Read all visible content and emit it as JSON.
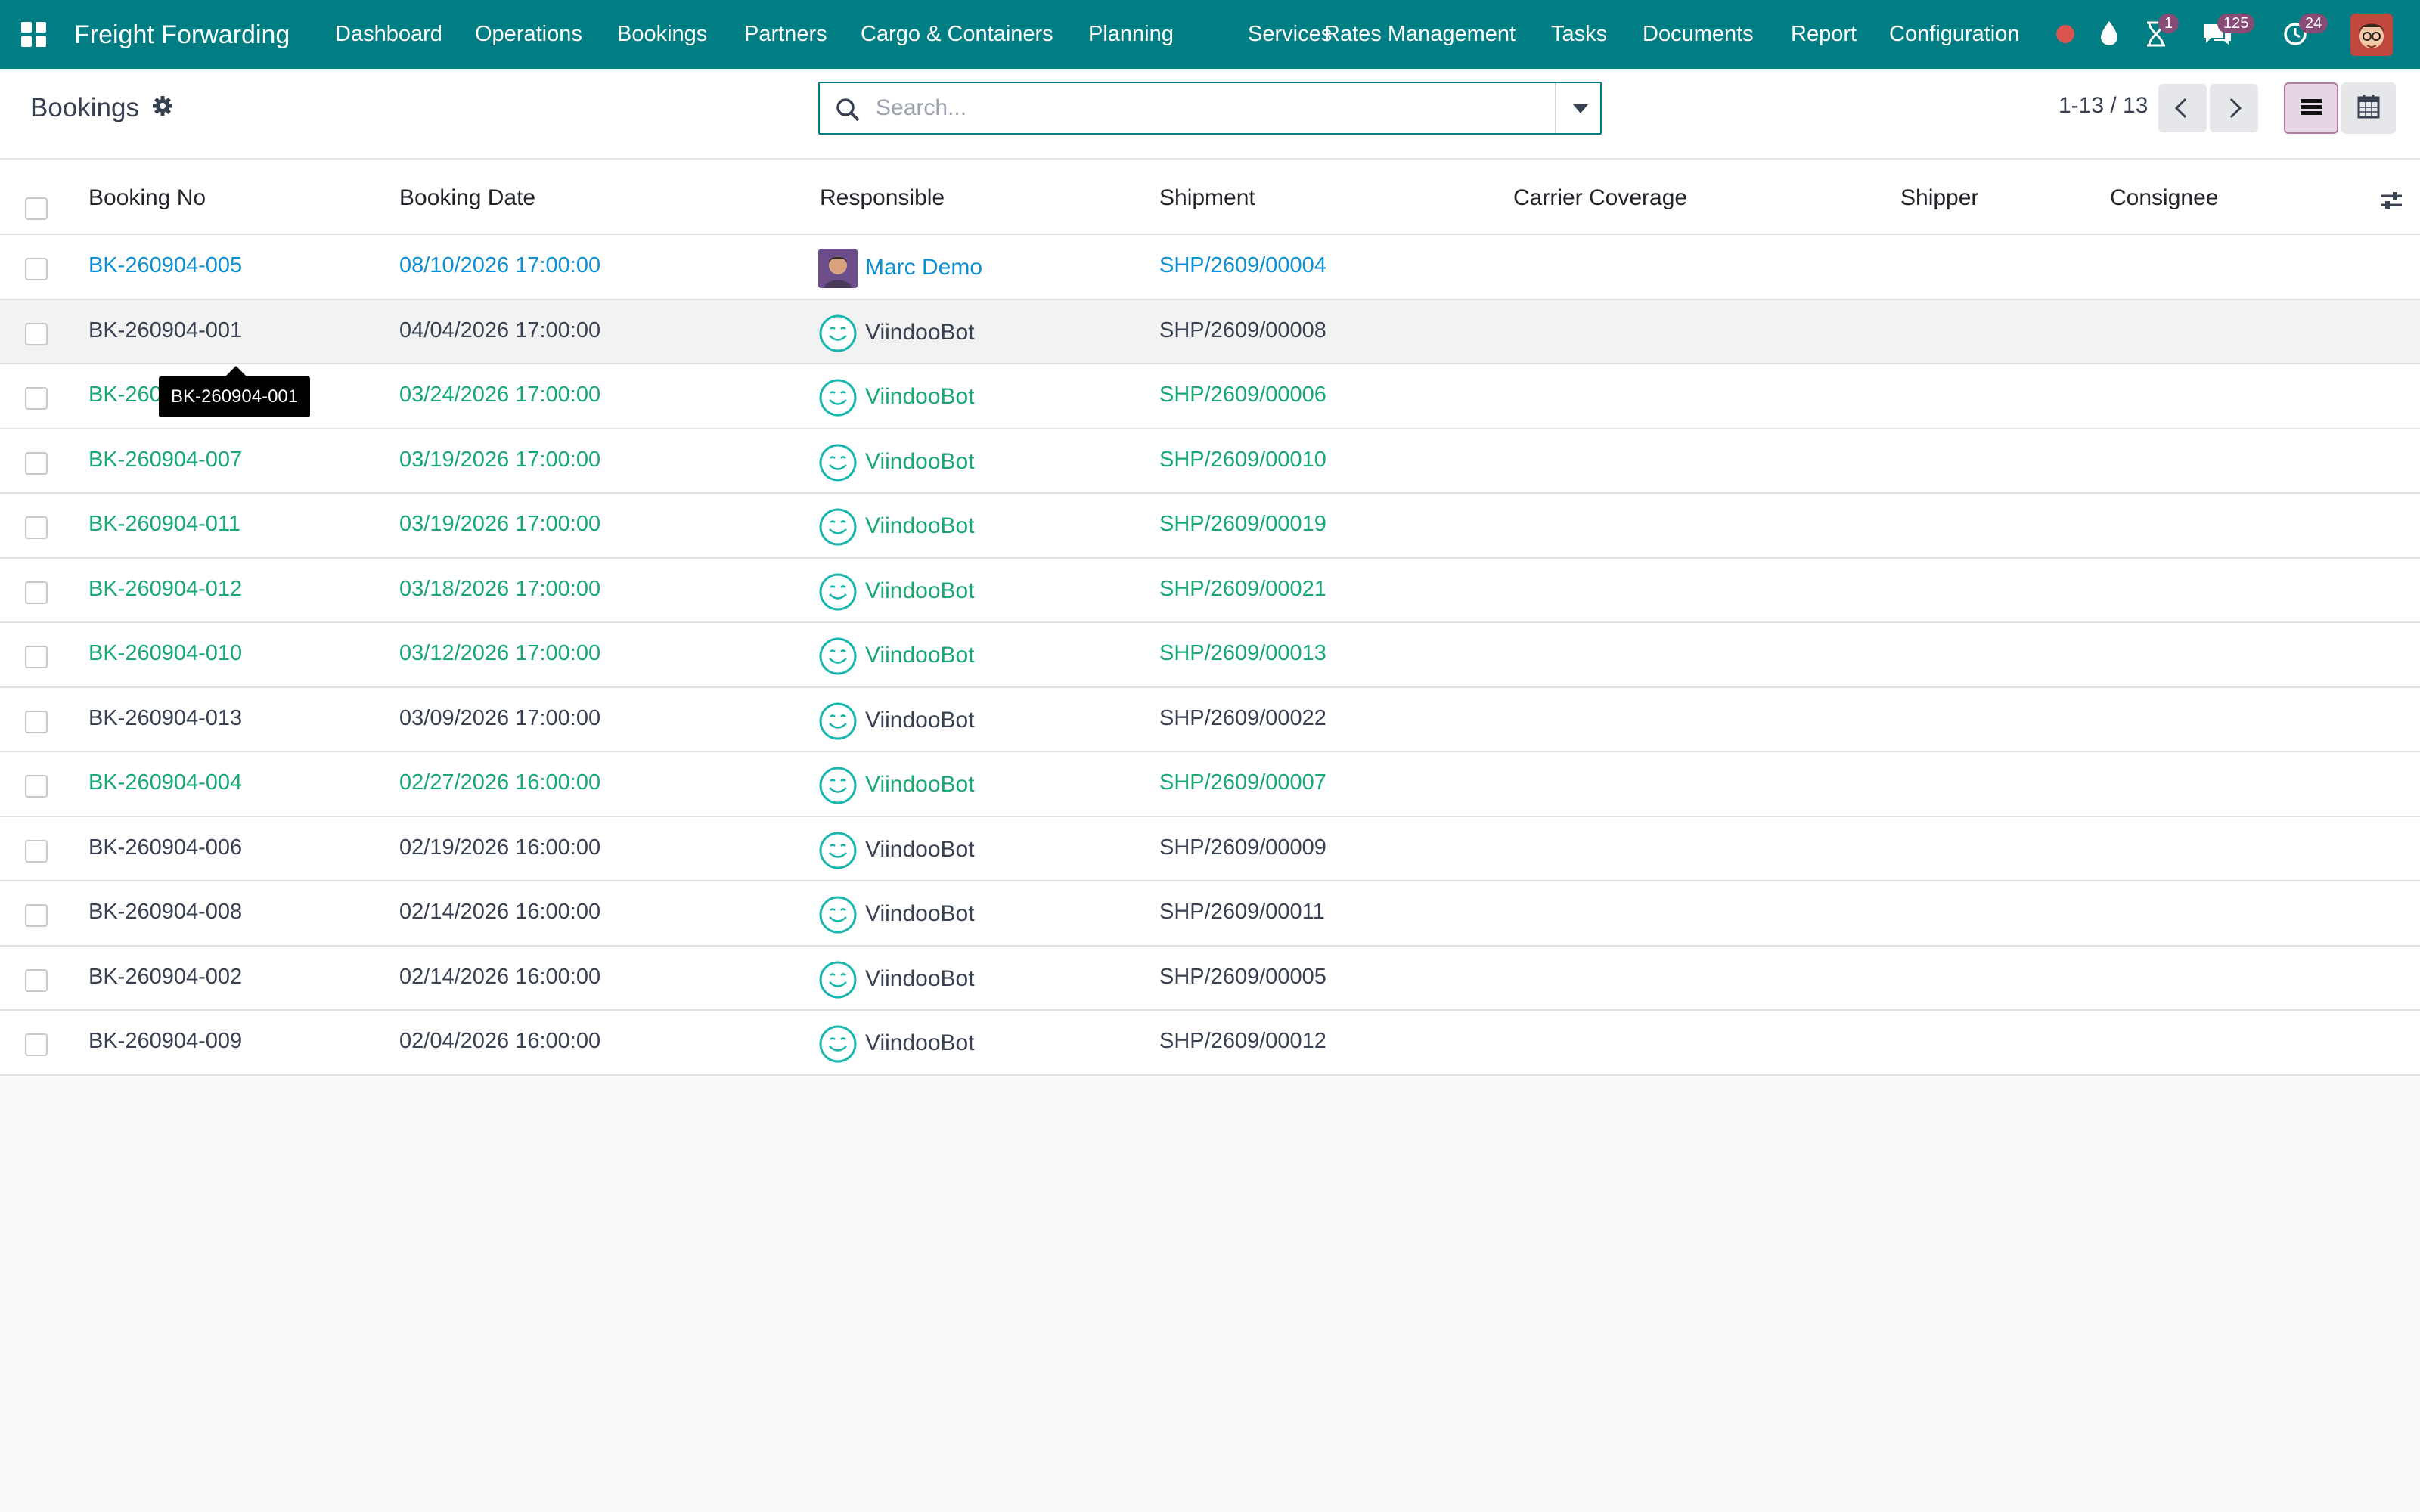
{
  "topbar": {
    "app_name": "Freight Forwarding",
    "menu": [
      "Dashboard",
      "Operations",
      "Bookings",
      "Partners",
      "Cargo & Containers",
      "Planning",
      "Services",
      "Rates Management",
      "Tasks",
      "Documents",
      "Report",
      "Configuration"
    ],
    "activity_badge": "1",
    "messages_badge": "125",
    "updates_badge": "24",
    "accent": "#017e84"
  },
  "control_panel": {
    "title": "Bookings",
    "search_placeholder": "Search...",
    "pager": "1-13 / 13"
  },
  "table": {
    "columns": [
      "Booking No",
      "Booking Date",
      "Responsible",
      "Shipment",
      "Carrier Coverage",
      "Shipper",
      "Consignee"
    ],
    "rows": [
      {
        "booking_no": "BK-260904-005",
        "date": "08/10/2026 17:00:00",
        "responsible": "Marc Demo",
        "shipment": "SHP/2609/00004",
        "carrier": "",
        "shipper": "",
        "consignee": "",
        "color": "blue"
      },
      {
        "booking_no": "BK-260904-001",
        "date": "04/04/2026 17:00:00",
        "responsible": "ViindooBot",
        "shipment": "SHP/2609/00008",
        "carrier": "",
        "shipper": "",
        "consignee": "",
        "color": "gray"
      },
      {
        "booking_no": "BK-260904-003",
        "date": "03/24/2026 17:00:00",
        "responsible": "ViindooBot",
        "shipment": "SHP/2609/00006",
        "carrier": "",
        "shipper": "",
        "consignee": "",
        "color": "green"
      },
      {
        "booking_no": "BK-260904-007",
        "date": "03/19/2026 17:00:00",
        "responsible": "ViindooBot",
        "shipment": "SHP/2609/00010",
        "carrier": "",
        "shipper": "",
        "consignee": "",
        "color": "green"
      },
      {
        "booking_no": "BK-260904-011",
        "date": "03/19/2026 17:00:00",
        "responsible": "ViindooBot",
        "shipment": "SHP/2609/00019",
        "carrier": "",
        "shipper": "",
        "consignee": "",
        "color": "green"
      },
      {
        "booking_no": "BK-260904-012",
        "date": "03/18/2026 17:00:00",
        "responsible": "ViindooBot",
        "shipment": "SHP/2609/00021",
        "carrier": "",
        "shipper": "",
        "consignee": "",
        "color": "green"
      },
      {
        "booking_no": "BK-260904-010",
        "date": "03/12/2026 17:00:00",
        "responsible": "ViindooBot",
        "shipment": "SHP/2609/00013",
        "carrier": "",
        "shipper": "",
        "consignee": "",
        "color": "green"
      },
      {
        "booking_no": "BK-260904-013",
        "date": "03/09/2026 17:00:00",
        "responsible": "ViindooBot",
        "shipment": "SHP/2609/00022",
        "carrier": "",
        "shipper": "",
        "consignee": "",
        "color": "gray"
      },
      {
        "booking_no": "BK-260904-004",
        "date": "02/27/2026 16:00:00",
        "responsible": "ViindooBot",
        "shipment": "SHP/2609/00007",
        "carrier": "",
        "shipper": "",
        "consignee": "",
        "color": "green"
      },
      {
        "booking_no": "BK-260904-006",
        "date": "02/19/2026 16:00:00",
        "responsible": "ViindooBot",
        "shipment": "SHP/2609/00009",
        "carrier": "",
        "shipper": "",
        "consignee": "",
        "color": "gray"
      },
      {
        "booking_no": "BK-260904-008",
        "date": "02/14/2026 16:00:00",
        "responsible": "ViindooBot",
        "shipment": "SHP/2609/00011",
        "carrier": "",
        "shipper": "",
        "consignee": "",
        "color": "gray"
      },
      {
        "booking_no": "BK-260904-002",
        "date": "02/14/2026 16:00:00",
        "responsible": "ViindooBot",
        "shipment": "SHP/2609/00005",
        "carrier": "",
        "shipper": "",
        "consignee": "",
        "color": "gray"
      },
      {
        "booking_no": "BK-260904-009",
        "date": "02/04/2026 16:00:00",
        "responsible": "ViindooBot",
        "shipment": "SHP/2609/00012",
        "carrier": "",
        "shipper": "",
        "consignee": "",
        "color": "gray"
      }
    ]
  },
  "tooltip": {
    "text": "BK-260904-001"
  }
}
